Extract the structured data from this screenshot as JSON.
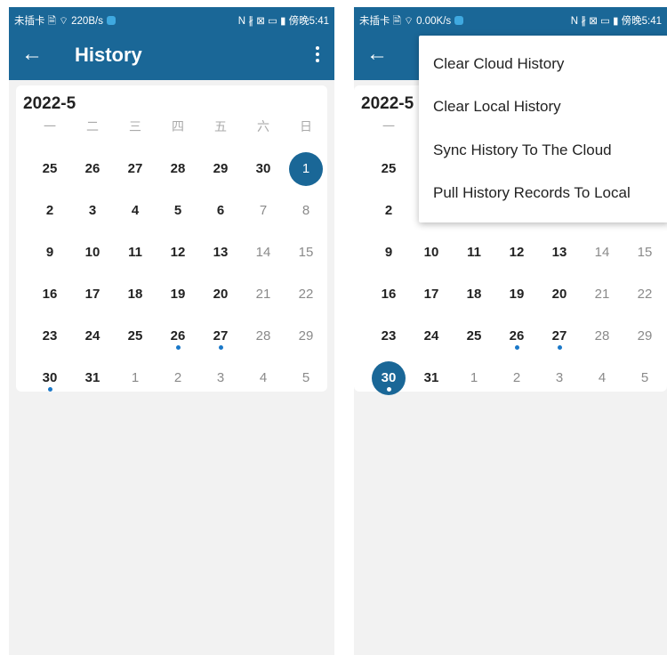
{
  "screens": [
    {
      "status": {
        "left": "未插卡 🗎 ⌔ 220B/s",
        "right": "N ∦ ⊠ ▭ ▮ 傍晚5:41"
      },
      "appbar": {
        "title": "History"
      },
      "calendar": {
        "month": "2022-5",
        "weekdays": [
          "一",
          "二",
          "三",
          "四",
          "五",
          "六",
          "日"
        ],
        "selected": "1",
        "marked": [
          "26",
          "27",
          "30"
        ]
      }
    },
    {
      "status": {
        "left": "未插卡 🗎 ⌔ 0.00K/s",
        "right": "N ∦ ⊠ ▭ ▮ 傍晚5:41"
      },
      "calendar": {
        "month": "2022-5",
        "weekdays": [
          "一",
          "二",
          "三",
          "四",
          "五",
          "六",
          "日"
        ],
        "selected": "30",
        "marked": [
          "26",
          "27",
          "30"
        ]
      },
      "menu": [
        "Clear Cloud History",
        "Clear Local History",
        "Sync History To The Cloud",
        "Pull History Records To Local"
      ]
    }
  ],
  "calendar_days": [
    [
      "25",
      "26",
      "27",
      "28",
      "29",
      "30",
      "1"
    ],
    [
      "2",
      "3",
      "4",
      "5",
      "6",
      "7",
      "8"
    ],
    [
      "9",
      "10",
      "11",
      "12",
      "13",
      "14",
      "15"
    ],
    [
      "16",
      "17",
      "18",
      "19",
      "20",
      "21",
      "22"
    ],
    [
      "23",
      "24",
      "25",
      "26",
      "27",
      "28",
      "29"
    ],
    [
      "30",
      "31",
      "1",
      "2",
      "3",
      "4",
      "5"
    ]
  ],
  "icons": {
    "back": "arrow-left-icon",
    "more": "more-vertical-icon",
    "shield": "shield-icon"
  },
  "colors": {
    "primary": "#1a6797",
    "dot": "#1a78c8",
    "background": "#f2f2f2"
  }
}
